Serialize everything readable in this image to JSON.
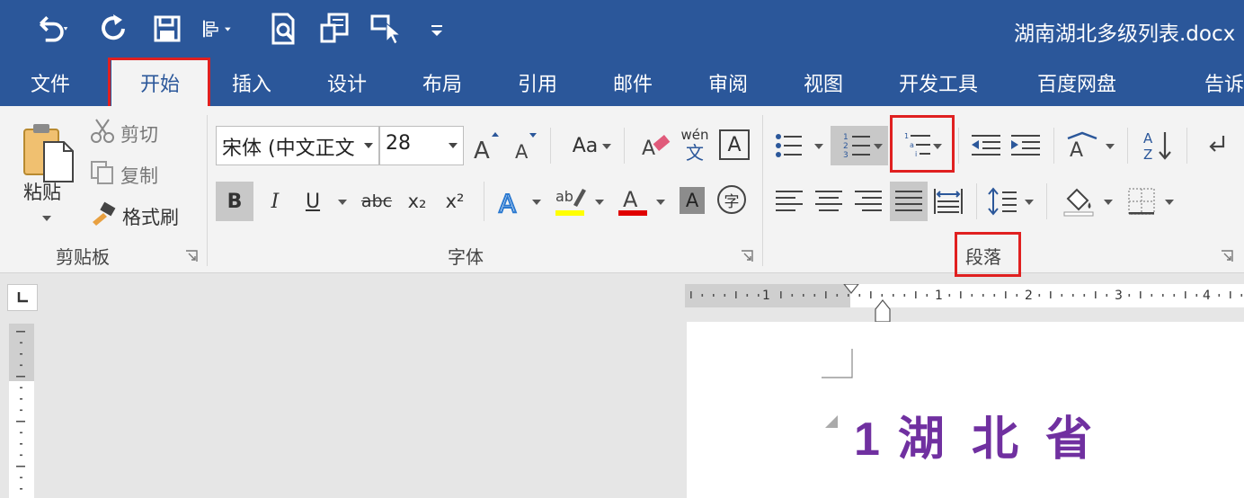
{
  "title_bar": {
    "document_title": "湖南湖北多级列表.docx"
  },
  "quick_access": [
    {
      "icon": "undo-icon"
    },
    {
      "icon": "redo-icon"
    },
    {
      "icon": "save-icon"
    },
    {
      "icon": "align-icon"
    },
    {
      "icon": "print-preview-icon"
    },
    {
      "icon": "copy-format-icon"
    },
    {
      "icon": "touch-mode-icon"
    },
    {
      "icon": "customize-icon"
    }
  ],
  "tabs": [
    {
      "label": "文件"
    },
    {
      "label": "开始"
    },
    {
      "label": "插入"
    },
    {
      "label": "设计"
    },
    {
      "label": "布局"
    },
    {
      "label": "引用"
    },
    {
      "label": "邮件"
    },
    {
      "label": "审阅"
    },
    {
      "label": "视图"
    },
    {
      "label": "开发工具"
    },
    {
      "label": "百度网盘"
    },
    {
      "label": "告诉"
    }
  ],
  "clipboard": {
    "paste_label": "粘贴",
    "cut_label": "剪切",
    "copy_label": "复制",
    "format_painter_label": "格式刷",
    "group_label": "剪贴板"
  },
  "font": {
    "font_name": "宋体 (中文正文",
    "font_size": "28",
    "change_case_label": "Aa",
    "phonetic_top": "wén",
    "phonetic_bottom": "文",
    "border_char": "A",
    "bold": "B",
    "italic": "I",
    "underline": "U",
    "strikethrough": "abc",
    "subscript": "x₂",
    "superscript": "x²",
    "char_shading": "A",
    "enclose_char": "字",
    "group_label": "字体",
    "highlight_color": "#ffff00",
    "font_color": "#e00000"
  },
  "paragraph": {
    "group_label": "段落"
  },
  "ruler": {
    "marks": [
      "1",
      "1",
      "2",
      "3",
      "4"
    ]
  },
  "document": {
    "heading_number": "1",
    "heading_text": "湖 北 省",
    "heading_color": "#7030a0"
  }
}
